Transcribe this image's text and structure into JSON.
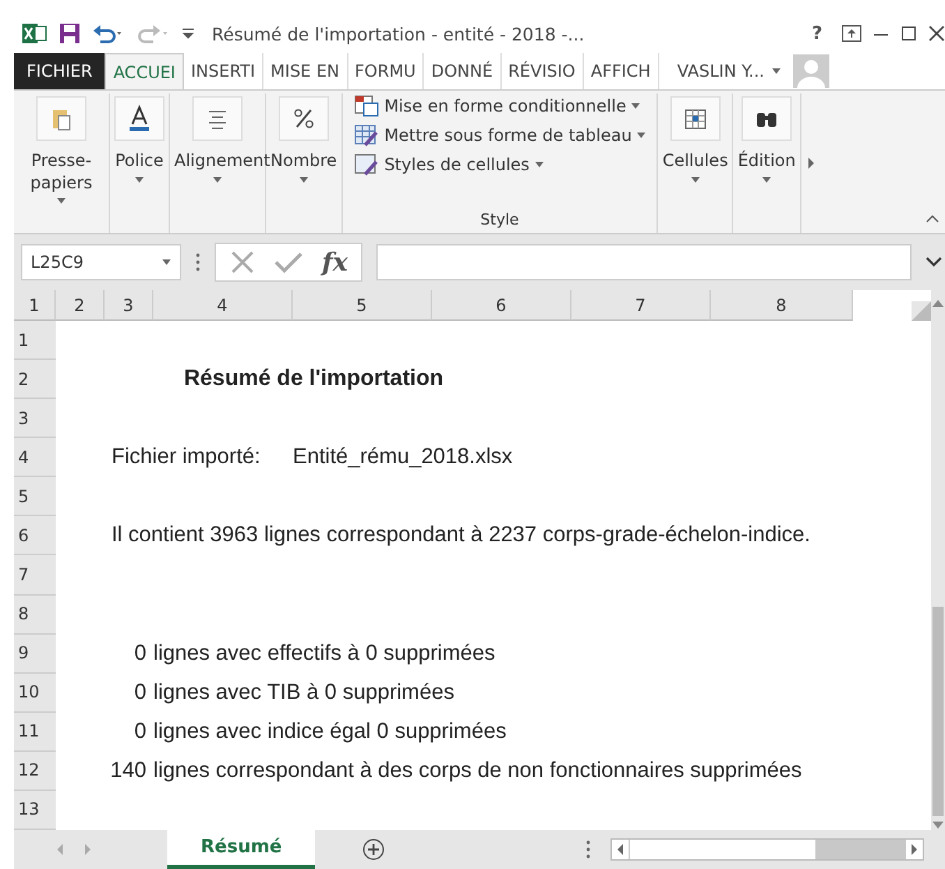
{
  "window": {
    "title": "Résumé de l'importation - entité - 2018 -...",
    "help": "?"
  },
  "tabs": [
    {
      "label": "FICHIER",
      "kind": "file",
      "selected": false
    },
    {
      "label": "ACCUEI",
      "kind": "tab",
      "selected": true
    },
    {
      "label": "INSERTI",
      "kind": "tab",
      "selected": false
    },
    {
      "label": "MISE EN",
      "kind": "tab",
      "selected": false
    },
    {
      "label": "FORMU",
      "kind": "tab",
      "selected": false
    },
    {
      "label": "DONNÉ",
      "kind": "tab",
      "selected": false
    },
    {
      "label": "RÉVISIO",
      "kind": "tab",
      "selected": false
    },
    {
      "label": "AFFICH",
      "kind": "tab",
      "selected": false
    }
  ],
  "user": {
    "name": "VASLIN Y..."
  },
  "ribbon": {
    "groups": [
      {
        "label": "Presse-papiers",
        "kind": "clipboard"
      },
      {
        "label": "Police",
        "kind": "font"
      },
      {
        "label": "Alignement",
        "kind": "align"
      },
      {
        "label": "Nombre",
        "kind": "number"
      }
    ],
    "style_group": {
      "label": "Style",
      "items": [
        {
          "label": "Mise en forme conditionnelle",
          "kind": "conditional"
        },
        {
          "label": "Mettre sous forme de tableau",
          "kind": "table"
        },
        {
          "label": "Styles de cellules",
          "kind": "cellstyle"
        }
      ]
    },
    "end_groups": [
      {
        "label": "Cellules",
        "kind": "cells"
      },
      {
        "label": "Édition",
        "kind": "edit"
      }
    ]
  },
  "formula_bar": {
    "name_box": "L25C9",
    "fx": "fx"
  },
  "columns": [
    "1",
    "2",
    "3",
    "4",
    "5",
    "6",
    "7",
    "8"
  ],
  "rows": [
    {
      "header": "1",
      "cells": []
    },
    {
      "header": "2",
      "cells": [
        {
          "text": "Résumé de l'importation",
          "kind": "title"
        }
      ]
    },
    {
      "header": "3",
      "cells": []
    },
    {
      "header": "4",
      "cells": [
        {
          "text": "Fichier importé:",
          "kind": "label"
        },
        {
          "text": "Entité_rému_2018.xlsx",
          "kind": "value"
        }
      ]
    },
    {
      "header": "5",
      "cells": []
    },
    {
      "header": "6",
      "cells": [
        {
          "text": "Il contient 3963 lignes correspondant à 2237 corps-grade-échelon-indice.",
          "kind": "label"
        }
      ]
    },
    {
      "header": "7",
      "cells": []
    },
    {
      "header": "8",
      "cells": []
    },
    {
      "header": "9",
      "cells": [
        {
          "text": "0",
          "kind": "count"
        },
        {
          "text": "lignes avec effectifs à 0 supprimées",
          "kind": "line"
        }
      ]
    },
    {
      "header": "10",
      "cells": [
        {
          "text": "0",
          "kind": "count"
        },
        {
          "text": "lignes avec TIB à 0 supprimées",
          "kind": "line"
        }
      ]
    },
    {
      "header": "11",
      "cells": [
        {
          "text": "0",
          "kind": "count"
        },
        {
          "text": "lignes avec indice égal 0  supprimées",
          "kind": "line"
        }
      ]
    },
    {
      "header": "12",
      "cells": [
        {
          "text": "140",
          "kind": "count"
        },
        {
          "text": "lignes correspondant à des corps de non fonctionnaires supprimées",
          "kind": "line"
        }
      ]
    },
    {
      "header": "13",
      "cells": []
    }
  ],
  "sheets": [
    {
      "label": "Résumé",
      "selected": true
    }
  ]
}
